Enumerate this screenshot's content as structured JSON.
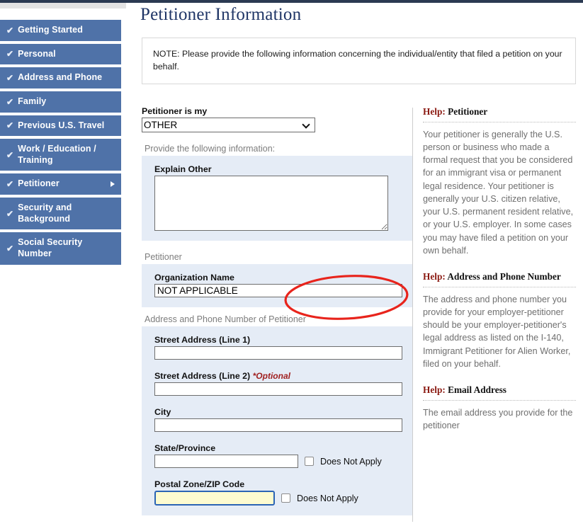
{
  "sidebar": {
    "items": [
      {
        "label": "Getting Started",
        "check": "✔",
        "active": false
      },
      {
        "label": "Personal",
        "check": "✔",
        "active": false
      },
      {
        "label": "Address and Phone",
        "check": "✔",
        "active": false
      },
      {
        "label": "Family",
        "check": "✔",
        "active": false
      },
      {
        "label": "Previous U.S. Travel",
        "check": "✔",
        "active": false
      },
      {
        "label": "Work / Education / Training",
        "check": "✔",
        "active": false
      },
      {
        "label": "Petitioner",
        "check": "✔",
        "active": true
      },
      {
        "label": "Security and Background",
        "check": "✔",
        "active": false
      },
      {
        "label": "Social Security Number",
        "check": "✔",
        "active": false
      }
    ]
  },
  "header": {
    "title": "Petitioner Information",
    "note": "NOTE: Please provide the following information concerning the individual/entity that filed a petition on your behalf."
  },
  "form": {
    "petitioner_is_my": {
      "label": "Petitioner is my",
      "value": "OTHER",
      "options": [
        "OTHER"
      ]
    },
    "provide_info_label": "Provide the following information:",
    "explain_other": {
      "label": "Explain Other",
      "value": "",
      "placeholder": ""
    },
    "petitioner_section_label": "Petitioner",
    "organization_name": {
      "label": "Organization Name",
      "value": "NOT APPLICABLE",
      "placeholder": ""
    },
    "address_section_label": "Address and Phone Number of Petitioner",
    "street1": {
      "label": "Street Address (Line 1)",
      "value": "",
      "placeholder": ""
    },
    "street2": {
      "label": "Street Address (Line 2)",
      "optional": "*Optional",
      "value": "",
      "placeholder": ""
    },
    "city": {
      "label": "City",
      "value": "",
      "placeholder": ""
    },
    "state": {
      "label": "State/Province",
      "value": "",
      "placeholder": "",
      "does_not_apply_label": "Does Not Apply",
      "does_not_apply_checked": false
    },
    "postal": {
      "label": "Postal Zone/ZIP Code",
      "value": "",
      "placeholder": "",
      "does_not_apply_label": "Does Not Apply",
      "does_not_apply_checked": false,
      "focused": true
    }
  },
  "help": [
    {
      "keyword": "Help:",
      "title": " Petitioner",
      "text": "Your petitioner is generally the U.S. person or business who made a formal request that you be considered for an immigrant visa or permanent legal residence. Your petitioner is generally your U.S. citizen relative, your U.S. permanent resident relative, or your U.S. employer. In some cases you may have filed a petition on your own behalf."
    },
    {
      "keyword": "Help:",
      "title": " Address and Phone Number",
      "text": "The address and phone number you provide for your employer-petitioner should be your employer-petitioner's legal address as listed on the I-140, Immigrant Petitioner for Alien Worker, filed on your behalf."
    },
    {
      "keyword": "Help:",
      "title": " Email Address",
      "text": "The email address you provide for the petitioner"
    }
  ],
  "colors": {
    "sidebar_item": "#4f72a8",
    "title": "#1f3566",
    "panel": "#e5ecf6",
    "help_keyword": "#8b1a12",
    "annotation": "#e8241c",
    "focus_field_bg": "#fdfbd0",
    "focus_field_border": "#2b64b5"
  }
}
